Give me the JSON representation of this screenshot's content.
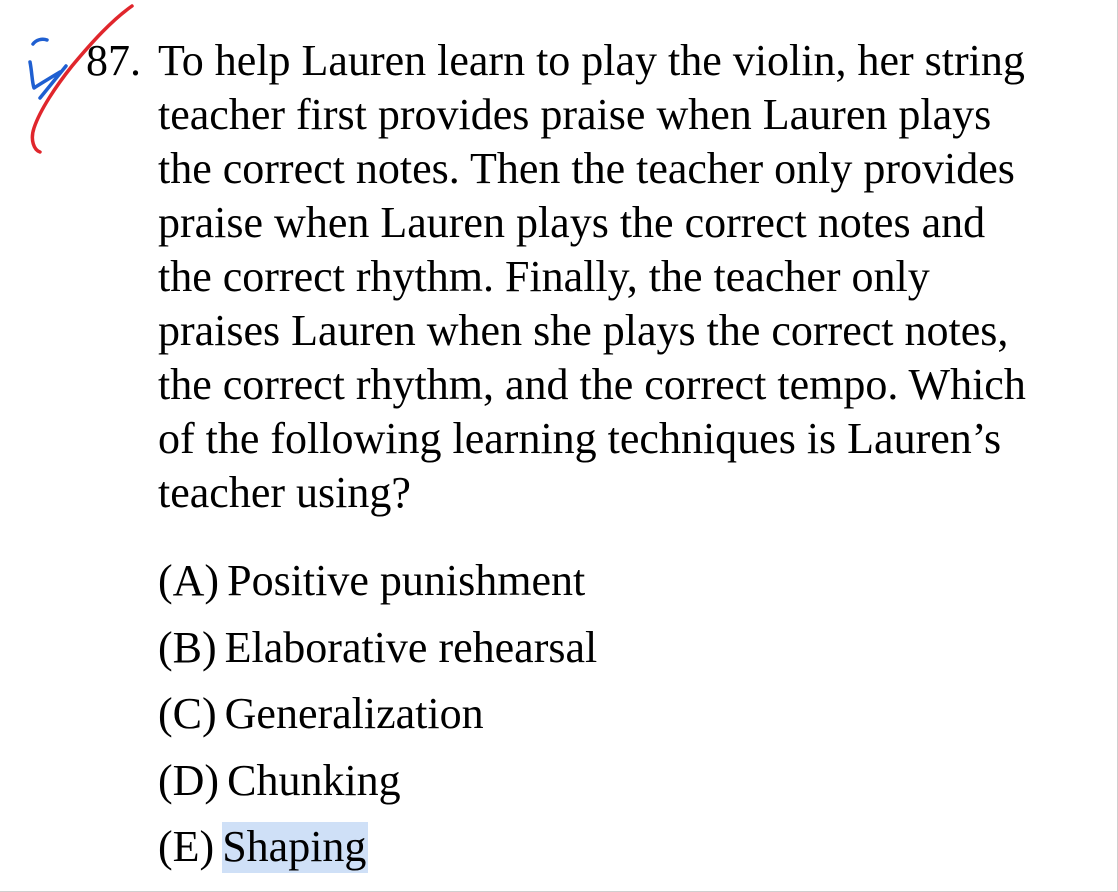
{
  "question": {
    "number": "87.",
    "lines": [
      "To help Lauren learn to play the violin, her string",
      "teacher first provides praise when Lauren plays",
      "the correct notes. Then the teacher only provides",
      "praise when Lauren plays the correct notes and",
      "the correct rhythm. Finally, the teacher only",
      "praises Lauren when she plays the correct notes,",
      "the correct rhythm, and the correct tempo. Which",
      "of the following learning techniques is Lauren’s",
      "teacher using?"
    ]
  },
  "choices": [
    {
      "letter": "(A)",
      "text": "Positive punishment"
    },
    {
      "letter": "(B)",
      "text": "Elaborative rehearsal"
    },
    {
      "letter": "(C)",
      "text": "Generalization"
    },
    {
      "letter": "(D)",
      "text": "Chunking"
    },
    {
      "letter": "(E)",
      "text": "Shaping"
    }
  ],
  "selected_choice": "(E)",
  "annotations": {
    "red_mark": "check-mark",
    "blue_mark": "handwritten-scribble",
    "red_color": "#e0262c",
    "blue_color": "#1f5fd1",
    "highlight_color": "#cfe0f7"
  }
}
